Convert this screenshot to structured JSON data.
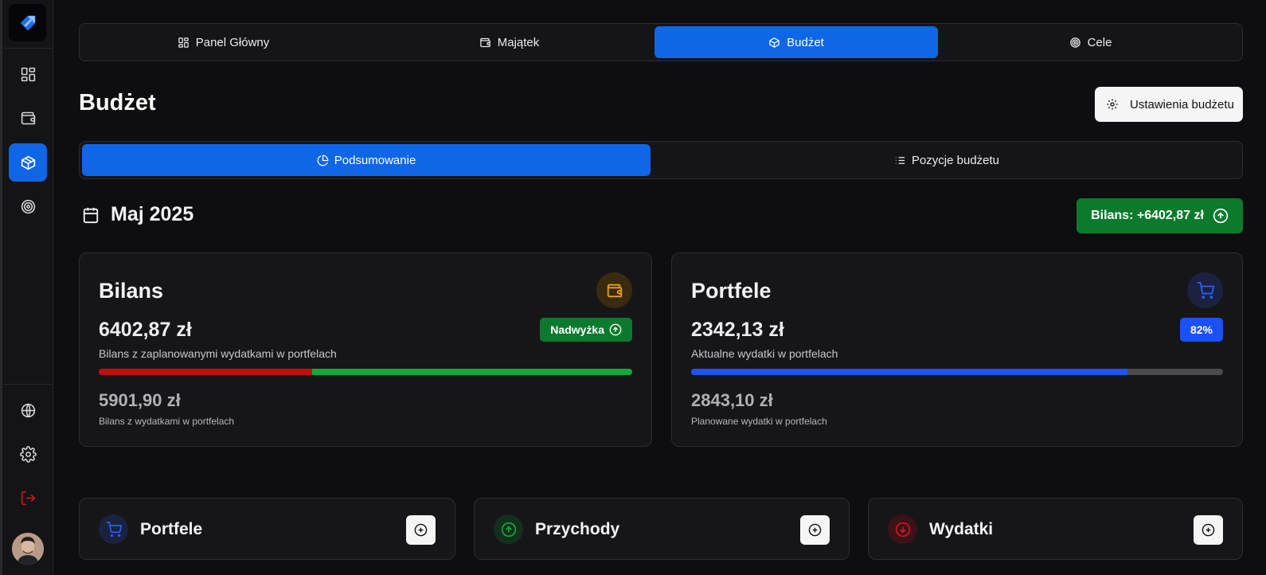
{
  "sidebar": {
    "items": [
      {
        "name": "dashboard",
        "icon": "dashboard-icon"
      },
      {
        "name": "assets",
        "icon": "wallet-icon"
      },
      {
        "name": "budget",
        "icon": "box-icon",
        "active": true
      },
      {
        "name": "goals",
        "icon": "target-icon"
      },
      {
        "name": "language",
        "icon": "globe-icon"
      },
      {
        "name": "settings",
        "icon": "gear-icon"
      },
      {
        "name": "logout",
        "icon": "logout-icon"
      }
    ]
  },
  "nav": {
    "tabs": [
      {
        "label": "Panel Główny",
        "icon": "dashboard-icon"
      },
      {
        "label": "Majątek",
        "icon": "wallet-icon"
      },
      {
        "label": "Budżet",
        "icon": "box-icon",
        "active": true
      },
      {
        "label": "Cele",
        "icon": "target-icon"
      }
    ]
  },
  "page": {
    "title": "Budżet",
    "settings_button": "Ustawienia budżetu"
  },
  "subnav": {
    "tabs": [
      {
        "label": "Podsumowanie",
        "icon": "pie-chart-icon",
        "active": true
      },
      {
        "label": "Pozycje budżetu",
        "icon": "list-icon"
      }
    ]
  },
  "period": {
    "label": "Maj 2025"
  },
  "balance_badge": {
    "label": "Bilans: +6402,87 zł"
  },
  "cards": {
    "balance": {
      "title": "Bilans",
      "amount": "6402,87 zł",
      "description": "Bilans z zaplanowanymi wydatkami w portfelach",
      "tag": "Nadwyżka",
      "progress_red_fraction": 0.4,
      "secondary_amount": "5901,90 zł",
      "secondary_description": "Bilans z wydatkami w portfelach",
      "colors": {
        "red": "#c10e0e",
        "green": "#12a83a",
        "icon_bg": "#3a2a10",
        "icon": "#e8a020"
      }
    },
    "wallets": {
      "title": "Portfele",
      "amount": "2342,13 zł",
      "description": "Aktualne wydatki w portfelach",
      "tag": "82%",
      "progress_fraction": 0.82,
      "secondary_amount": "2843,10 zł",
      "secondary_description": "Planowane wydatki w portfelach",
      "colors": {
        "fill": "#1f54f0",
        "track": "#4a4a4f",
        "icon_bg": "#1a2240",
        "icon": "#2d5ef5",
        "tag_bg": "#1a52f5"
      }
    }
  },
  "bottom_cards": [
    {
      "title": "Portfele",
      "icon": "cart-icon",
      "color": "#2d5ef5",
      "bg": "#1a2240"
    },
    {
      "title": "Przychody",
      "icon": "arrow-up-circle-icon",
      "color": "#14a83c",
      "bg": "#13301c"
    },
    {
      "title": "Wydatki",
      "icon": "arrow-down-circle-icon",
      "color": "#d6141c",
      "bg": "#3a1218"
    }
  ],
  "colors": {
    "accent": "#0f66e6",
    "success": "#0c7a2d"
  }
}
